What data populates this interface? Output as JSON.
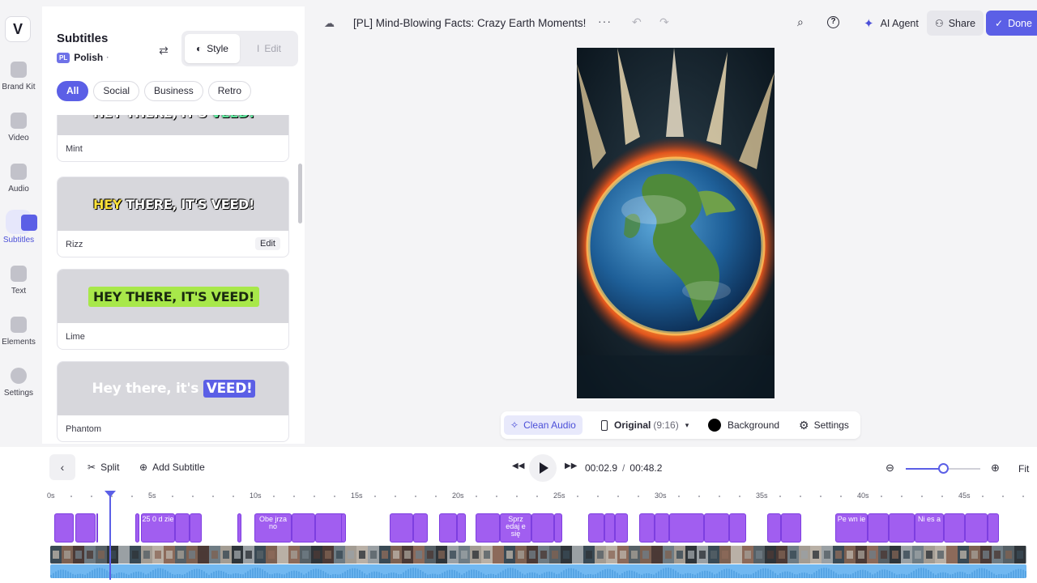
{
  "rail": {
    "logo": "V",
    "items": [
      {
        "label": "Brand Kit",
        "icon": "brand-kit-icon"
      },
      {
        "label": "Video",
        "icon": "video-icon"
      },
      {
        "label": "Audio",
        "icon": "audio-icon"
      },
      {
        "label": "Subtitles",
        "icon": "subtitles-icon",
        "active": true
      },
      {
        "label": "Text",
        "icon": "text-icon"
      },
      {
        "label": "Elements",
        "icon": "elements-icon"
      },
      {
        "label": "Settings",
        "icon": "settings-icon"
      }
    ]
  },
  "panel": {
    "title": "Subtitles",
    "language_badge": "PL",
    "language": "Polish",
    "style_tab": "Style",
    "edit_tab": "Edit",
    "chips": [
      "All",
      "Social",
      "Business",
      "Retro"
    ],
    "active_chip": "All",
    "cards": [
      {
        "name": "Mint",
        "caption_main": "HEY THERE, IT'S ",
        "caption_hl": "VEED!"
      },
      {
        "name": "Rizz",
        "caption_hl": "HEY",
        "caption_main": " THERE, IT'S VEED!",
        "edit_label": "Edit"
      },
      {
        "name": "Lime",
        "caption": "HEY THERE, IT'S VEED!"
      },
      {
        "name": "Phantom",
        "caption_main": "Hey there, it's ",
        "caption_hl": "VEED!"
      }
    ]
  },
  "topbar": {
    "project_title": "[PL] Mind-Blowing Facts: Crazy Earth Moments!",
    "more": "···",
    "ai_agent": "AI Agent",
    "share": "Share",
    "done": "Done"
  },
  "toolbar": {
    "clean_audio": "Clean Audio",
    "original": "Original",
    "ratio": "(9:16)",
    "background": "Background",
    "settings": "Settings"
  },
  "timeline": {
    "split": "Split",
    "add_subtitle": "Add Subtitle",
    "current_time": "00:02.9",
    "separator": "/",
    "total_time": "00:48.2",
    "fit": "Fit",
    "zoom_level": 0.5,
    "ruler_labels": [
      "0s",
      "5s",
      "10s",
      "15s",
      "20s",
      "25s",
      "30s",
      "35s",
      "40s",
      "45s"
    ],
    "clip_texts": [
      "25 0 d zie",
      "Obe jrza no",
      "Sprz edaj e się",
      "Pe wn ie",
      "Ni es a"
    ]
  },
  "colors": {
    "accent": "#5b5fe6",
    "clip": "#a15ef0",
    "audio": "#71b8f1"
  }
}
